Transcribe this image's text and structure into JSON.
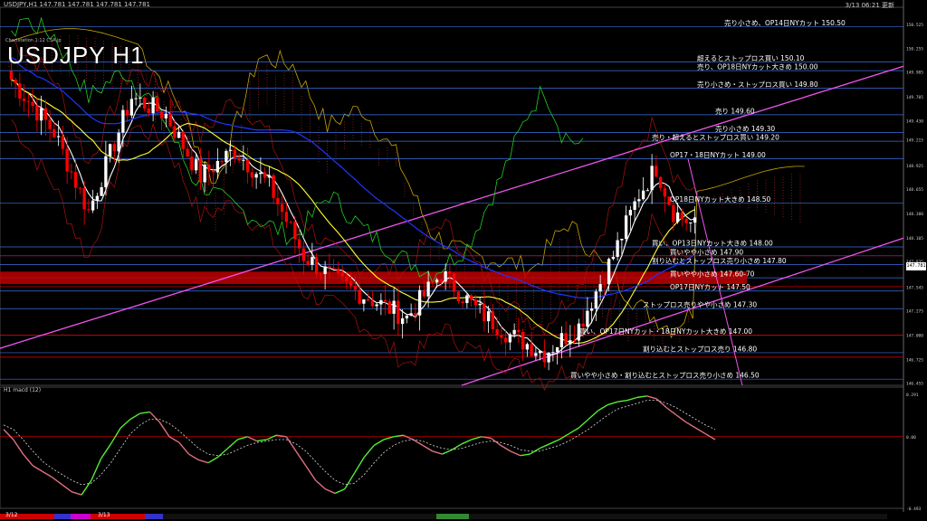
{
  "header": {
    "info": "USDJPY,H1  147.781 147.781 147.781 147.781",
    "time": "3/13 06:21 更新",
    "title": "USDJPY  H1",
    "subtitle": "Chartstation 1:12 CSA.jp",
    "macd_label": "H1  macd (12)",
    "current_price": "147.781"
  },
  "colors": {
    "background": "#000000",
    "bull_candle": "#ffffff",
    "bear_candle": "#ff0000",
    "sma_short": "#ffffff",
    "sma_mid": "#ffff33",
    "sma_long": "#2233ff",
    "lagging_span": "#22cc22",
    "channel": "#ee55ee",
    "level_line": "#3d6fe0",
    "red_level": "#cc0000",
    "kumo_red": "#d43030",
    "kumo_blue": "#6a8fe8",
    "span_b": "#c8a300",
    "macd": "#55ee33",
    "macd_signal": "#e07080"
  },
  "chart_data": [
    {
      "type": "candlestick",
      "title": "USDJPY H1",
      "ylim": [
        146.43,
        150.72
      ],
      "y_ticks": [
        "150.525",
        "150.255",
        "149.985",
        "149.705",
        "149.430",
        "149.215",
        "148.925",
        "148.655",
        "148.380",
        "148.105",
        "147.835",
        "147.545",
        "147.275",
        "147.000",
        "146.725",
        "146.455"
      ],
      "y_tick_values": [
        150.525,
        150.255,
        149.985,
        149.705,
        149.43,
        149.215,
        148.925,
        148.655,
        148.38,
        148.105,
        147.835,
        147.545,
        147.275,
        147.0,
        146.725,
        146.455
      ],
      "annotations": [
        {
          "text": "売り小さめ、OP14日NYカット 150.50",
          "price": 150.5,
          "x": 0.8
        },
        {
          "text": "超えるとストップロス買い 150.10",
          "price": 150.1,
          "x": 0.77
        },
        {
          "text": "売り、OP18日NYカット大きめ 150.00",
          "price": 150.0,
          "x": 0.77
        },
        {
          "text": "売り小さめ・ストップロス買い 149.80",
          "price": 149.8,
          "x": 0.77
        },
        {
          "text": "売り 149.60",
          "price": 149.5,
          "x": 0.79
        },
        {
          "text": "売り小さめ 149.30",
          "price": 149.3,
          "x": 0.79
        },
        {
          "text": "売り・超えるとストップロス買い 149.20",
          "price": 149.2,
          "x": 0.72
        },
        {
          "text": "OP17・18日NYカット 149.00",
          "price": 149.0,
          "x": 0.74
        },
        {
          "text": "OP18日NYカット大きめ 148.50",
          "price": 148.5,
          "x": 0.74
        },
        {
          "text": "買い、OP13日NYカット大きめ 148.00",
          "price": 148.0,
          "x": 0.72
        },
        {
          "text": "買いやや小さめ 147.90",
          "price": 147.9,
          "x": 0.74
        },
        {
          "text": "割り込むとストップロス売り小さめ 147.80",
          "price": 147.8,
          "x": 0.72
        },
        {
          "text": "買いやや小さめ 147.60-70",
          "price": 147.65,
          "x": 0.74
        },
        {
          "text": "OP17日NYカット 147.50",
          "price": 147.5,
          "x": 0.74
        },
        {
          "text": "ストップロス売りやや小さめ 147.30",
          "price": 147.3,
          "x": 0.71
        },
        {
          "text": "買い、OP17日NYカット・18日NYカット大きめ 147.00",
          "price": 147.0,
          "x": 0.64
        },
        {
          "text": "割り込むとストップロス売り 146.80",
          "price": 146.8,
          "x": 0.71
        },
        {
          "text": "買いやや小さめ・割り込むとストップロス売り小さめ 146.50",
          "price": 146.5,
          "x": 0.63
        }
      ],
      "candle_count": 160
    },
    {
      "type": "line",
      "title": "H1  macd (12)",
      "ylim": [
        -0.493,
        0.291
      ],
      "y_ticks": [
        "0.291",
        "0.00",
        "-0.493"
      ],
      "y_tick_values": [
        0.291,
        0.0,
        -0.493
      ],
      "series": [
        {
          "values": [
            0.05,
            -0.02,
            -0.12,
            -0.2,
            -0.24,
            -0.28,
            -0.33,
            -0.38,
            -0.4,
            -0.3,
            -0.15,
            -0.05,
            0.06,
            0.12,
            0.16,
            0.17,
            0.1,
            0.0,
            -0.04,
            -0.12,
            -0.16,
            -0.18,
            -0.14,
            -0.08,
            -0.02,
            0.0,
            -0.03,
            -0.02,
            0.01,
            0.0,
            -0.1,
            -0.2,
            -0.3,
            -0.36,
            -0.39,
            -0.36,
            -0.25,
            -0.14,
            -0.06,
            -0.02,
            0.0,
            0.01,
            -0.02,
            -0.06,
            -0.1,
            -0.12,
            -0.09,
            -0.05,
            -0.02,
            0.0,
            -0.01,
            -0.06,
            -0.1,
            -0.13,
            -0.12,
            -0.08,
            -0.05,
            -0.02,
            0.02,
            0.06,
            0.12,
            0.18,
            0.22,
            0.24,
            0.25,
            0.27,
            0.28,
            0.26,
            0.2,
            0.15,
            0.1,
            0.06,
            0.02,
            -0.02
          ]
        },
        {
          "values": [
            0.08,
            0.05,
            -0.02,
            -0.1,
            -0.17,
            -0.22,
            -0.26,
            -0.3,
            -0.33,
            -0.32,
            -0.26,
            -0.18,
            -0.08,
            0.02,
            0.08,
            0.12,
            0.12,
            0.09,
            0.04,
            -0.02,
            -0.08,
            -0.12,
            -0.13,
            -0.12,
            -0.09,
            -0.06,
            -0.04,
            -0.03,
            -0.02,
            -0.02,
            -0.05,
            -0.1,
            -0.17,
            -0.24,
            -0.3,
            -0.33,
            -0.32,
            -0.26,
            -0.18,
            -0.11,
            -0.06,
            -0.03,
            -0.02,
            -0.03,
            -0.06,
            -0.08,
            -0.09,
            -0.08,
            -0.06,
            -0.04,
            -0.03,
            -0.04,
            -0.06,
            -0.09,
            -0.1,
            -0.1,
            -0.08,
            -0.06,
            -0.03,
            0.01,
            0.05,
            0.1,
            0.15,
            0.19,
            0.21,
            0.23,
            0.25,
            0.25,
            0.23,
            0.2,
            0.16,
            0.12,
            0.08,
            0.05
          ]
        }
      ]
    }
  ],
  "bottom_bar": {
    "labels": [
      "3/12",
      "3/13"
    ]
  }
}
